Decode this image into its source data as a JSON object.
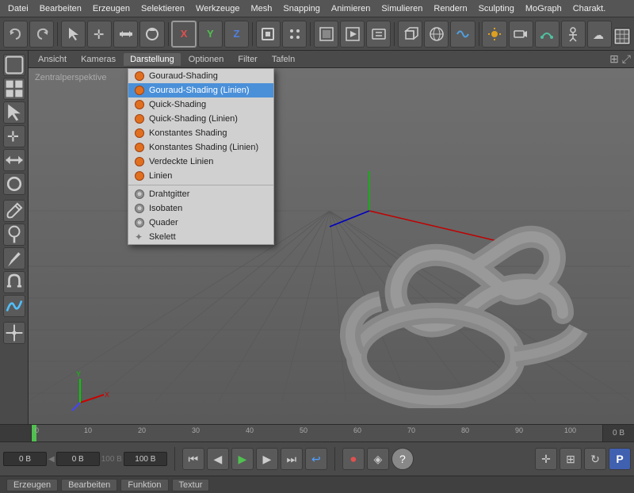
{
  "menubar": {
    "items": [
      "Datei",
      "Bearbeiten",
      "Erzeugen",
      "Selektieren",
      "Werkzeuge",
      "Mesh",
      "Snapping",
      "Animieren",
      "Simulieren",
      "Rendern",
      "Sculpting",
      "MoGraph",
      "Charakt."
    ]
  },
  "viewport_tabs": {
    "items": [
      "Ansicht",
      "Kameras",
      "Darstellung",
      "Optionen",
      "Filter",
      "Tafeln"
    ]
  },
  "viewport_label": "Zentralperspektive",
  "dropdown": {
    "items": [
      {
        "label": "Gouraud-Shading",
        "icon": "orange-dot"
      },
      {
        "label": "Gouraud-Shading (Linien)",
        "icon": "orange-dot",
        "highlighted": true
      },
      {
        "label": "Quick-Shading",
        "icon": "orange-dot"
      },
      {
        "label": "Quick-Shading (Linien)",
        "icon": "orange-dot"
      },
      {
        "label": "Konstantes Shading",
        "icon": "orange-dot"
      },
      {
        "label": "Konstantes Shading (Linien)",
        "icon": "orange-dot"
      },
      {
        "label": "Verdeckte Linien",
        "icon": "orange-dot"
      },
      {
        "label": "Linien",
        "icon": "orange-dot"
      },
      {
        "separator": true
      },
      {
        "label": "Drahtgitter",
        "icon": "globe"
      },
      {
        "label": "Isobaten",
        "icon": "globe"
      },
      {
        "label": "Quader",
        "icon": "globe"
      },
      {
        "label": "Skelett",
        "icon": "star"
      }
    ]
  },
  "timeline": {
    "marks": [
      {
        "pos": 0,
        "label": "0"
      },
      {
        "pos": 68,
        "label": "10"
      },
      {
        "pos": 136,
        "label": "20"
      },
      {
        "pos": 204,
        "label": "30"
      },
      {
        "pos": 272,
        "label": "40"
      },
      {
        "pos": 340,
        "label": "50"
      },
      {
        "pos": 408,
        "label": "60"
      },
      {
        "pos": 476,
        "label": "70"
      },
      {
        "pos": 544,
        "label": "80"
      },
      {
        "pos": 612,
        "label": "90"
      },
      {
        "pos": 680,
        "label": "100"
      }
    ]
  },
  "bottom_controls": {
    "frame_display": "0 B",
    "field1_label": "",
    "field1_value": "0 B",
    "field2_value": "100 B",
    "field3_value": "100 B"
  },
  "status_bar": {
    "items": [
      "Erzeugen",
      "Bearbeiten",
      "Funktion",
      "Textur"
    ]
  }
}
